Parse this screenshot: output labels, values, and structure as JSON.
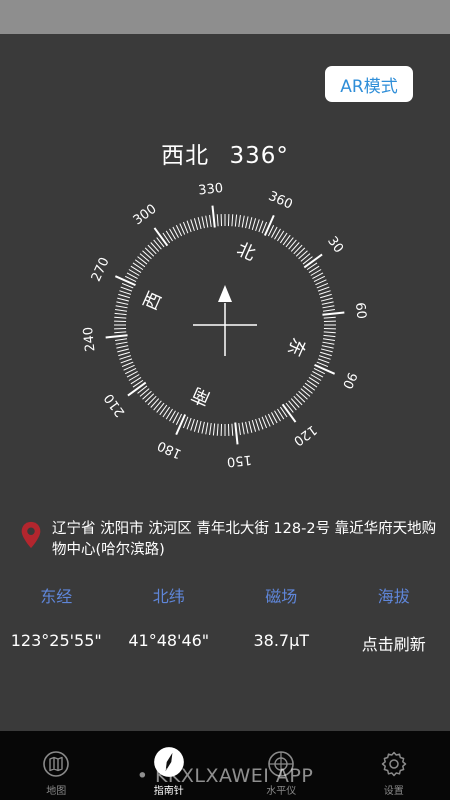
{
  "ar_button": {
    "label": "AR模式"
  },
  "compass": {
    "direction": "西北",
    "degrees": "336°",
    "cardinals": {
      "north": "北",
      "east": "东",
      "south": "南",
      "west": "西"
    },
    "tick_labels": [
      "360",
      "30",
      "60",
      "90",
      "120",
      "150",
      "180",
      "210",
      "240",
      "270",
      "300",
      "330"
    ]
  },
  "location": {
    "address": "辽宁省 沈阳市 沈河区 青年北大街 128-2号 靠近华府天地购物中心(哈尔滨路)"
  },
  "stats": {
    "longitude_label": "东经",
    "latitude_label": "北纬",
    "magnetic_label": "磁场",
    "altitude_label": "海拔",
    "longitude_value": "123°25'55\"",
    "latitude_value": "41°48'46\"",
    "magnetic_value": "38.7μT",
    "altitude_value": "点击刷新"
  },
  "nav": {
    "map": "地图",
    "compass": "指南针",
    "level": "水平仪",
    "settings": "设置"
  },
  "watermark": "• KKXLXAWEI APP",
  "colors": {
    "background": "#3a3a3a",
    "accent_blue": "#5f86d9",
    "pin_red": "#b3262e"
  }
}
